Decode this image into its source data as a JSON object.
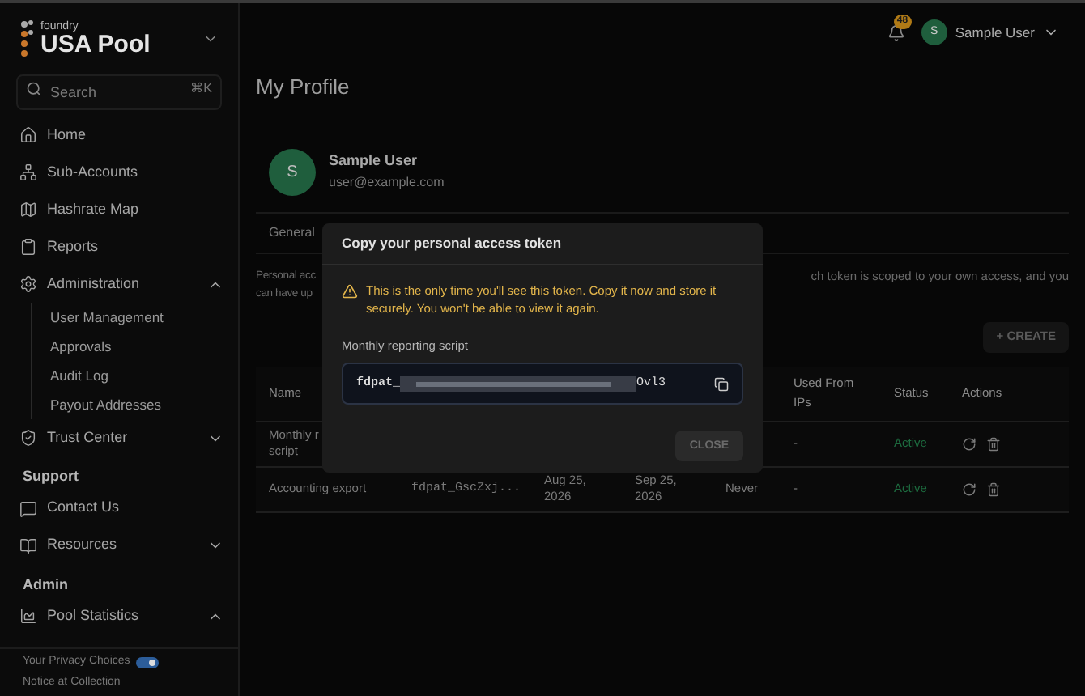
{
  "sidebar": {
    "brand_small": "foundry",
    "brand": "USA Pool",
    "search": {
      "placeholder": "Search",
      "shortcut": "⌘K"
    },
    "items": [
      {
        "kind": "link",
        "label": "Home"
      },
      {
        "kind": "link",
        "label": "Sub-Accounts"
      },
      {
        "kind": "link",
        "label": "Hashrate Map"
      },
      {
        "kind": "link",
        "label": "Reports"
      },
      {
        "kind": "group",
        "label": "Administration",
        "expanded": true,
        "children": [
          {
            "label": "User Management"
          },
          {
            "label": "Approvals"
          },
          {
            "label": "Audit Log"
          },
          {
            "label": "Payout Addresses"
          }
        ]
      },
      {
        "kind": "group",
        "label": "Trust Center",
        "expanded": false
      },
      {
        "kind": "heading",
        "label": "Support"
      },
      {
        "kind": "link",
        "label": "Contact Us"
      },
      {
        "kind": "group",
        "label": "Resources",
        "expanded": false
      },
      {
        "kind": "heading",
        "label": "Admin"
      },
      {
        "kind": "group",
        "label": "Pool Statistics",
        "expanded": true
      }
    ],
    "footer": [
      "Your Privacy Choices",
      "Notice at Collection"
    ]
  },
  "header": {
    "notifications": "48",
    "user": "Sample User",
    "avatar": "S"
  },
  "page": {
    "title": "My Profile",
    "profile": {
      "avatar": "S",
      "name": "Sample User",
      "email": "user@example.com"
    },
    "tabs": [
      {
        "label": "General",
        "selected": false
      }
    ],
    "description_left": "Personal acc\ncan have up",
    "description_right": "ch token is scoped to your own access, and you",
    "create_button": {
      "label": "+ CREATE",
      "disabled": true
    },
    "table": {
      "columns": [
        {
          "label": "Name"
        },
        {
          "label": "Used From IPs"
        },
        {
          "label": "Status"
        },
        {
          "label": "Actions"
        }
      ],
      "rows": [
        {
          "name": "Monthly r\nscript",
          "ips": "-",
          "status": "Active"
        },
        {
          "name": "Accounting export",
          "token": "fdpat_GscZxj...",
          "created": "Aug 25,\n2026",
          "expires": "Sep 25,\n2026",
          "last_used": "Never",
          "ips": "-",
          "status": "Active"
        }
      ]
    }
  },
  "dialog": {
    "title": "Copy your personal access token",
    "warning": "This is the only time you'll see this token. Copy it now and store it securely. You won't be able to view it again.",
    "token_label": "Monthly reporting script",
    "token_prefix": "fdpat_",
    "token_suffix": "Ovl3",
    "close": {
      "label": "CLOSE",
      "disabled": true
    }
  }
}
